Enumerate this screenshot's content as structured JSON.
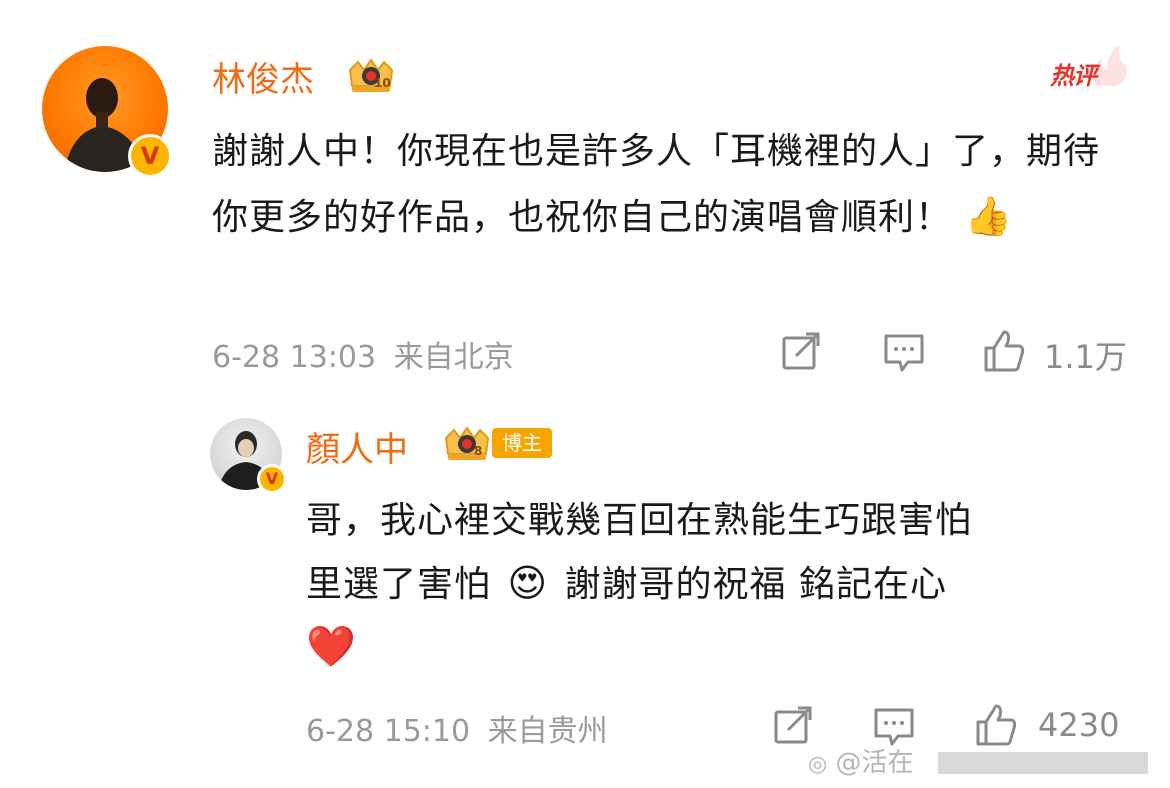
{
  "comment": {
    "author": "林俊杰",
    "badge_level": "10",
    "hot_label": "热评",
    "text": "謝謝人中！你現在也是許多人「耳機裡的人」了，期待你更多的好作品，也祝你自己的演唱會順利！",
    "emoji": "👍",
    "date": "6-28 13:03",
    "location": "来自北京",
    "like_count": "1.1万"
  },
  "reply": {
    "author": "顏人中",
    "badge_level": "8",
    "blogger_label": "博主",
    "text_line1": "哥，我心裡交戰幾百回在熟能生巧跟害怕",
    "text_line2a": "里選了害怕",
    "text_emoji": "😍",
    "text_line2b": "謝謝哥的祝福 銘記在心",
    "heart": "❤️",
    "date": "6-28 15:10",
    "location": "来自贵州",
    "like_count": "4230"
  },
  "watermark": {
    "text": "@活在"
  },
  "colors": {
    "name": "#f26b14",
    "meta": "#9a9a9a",
    "hot": "#e8312b",
    "blogger_tag": "#f7a400",
    "verified_badge": "#ffb400"
  },
  "icons": [
    "repost-icon",
    "comment-icon",
    "like-icon",
    "crown-badge-icon",
    "verified-v-icon"
  ]
}
